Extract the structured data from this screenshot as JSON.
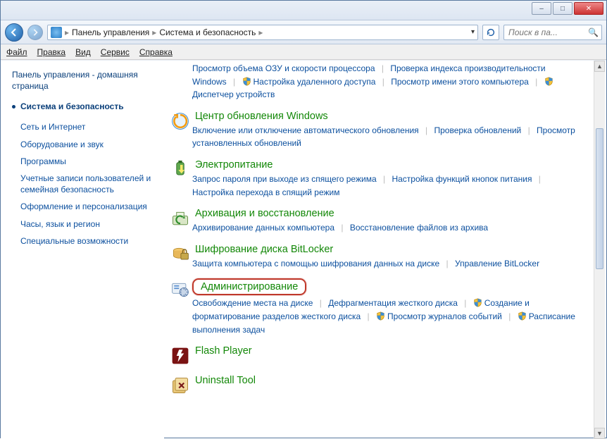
{
  "window": {
    "minimize": "–",
    "maximize": "□",
    "close": "✕"
  },
  "breadcrumb": {
    "root": "Панель управления",
    "current": "Система и безопасность"
  },
  "search": {
    "placeholder": "Поиск в па..."
  },
  "menubar": {
    "file": "Файл",
    "edit": "Правка",
    "view": "Вид",
    "tools": "Сервис",
    "help": "Справка"
  },
  "sidebar": {
    "home": "Панель управления - домашняя страница",
    "active": "Система и безопасность",
    "items": [
      "Сеть и Интернет",
      "Оборудование и звук",
      "Программы",
      "Учетные записи пользователей и семейная безопасность",
      "Оформление и персонализация",
      "Часы, язык и регион",
      "Специальные возможности"
    ]
  },
  "top_links": [
    {
      "label": "Просмотр объема ОЗУ и скорости процессора",
      "shield": false
    },
    {
      "label": "Проверка индекса производительности Windows",
      "shield": false
    },
    {
      "label": "Настройка удаленного доступа",
      "shield": true
    },
    {
      "label": "Просмотр имени этого компьютера",
      "shield": false
    },
    {
      "label": "Диспетчер устройств",
      "shield": true
    }
  ],
  "categories": [
    {
      "id": "windows-update",
      "title": "Центр обновления Windows",
      "icon": "windows-update-icon",
      "links": [
        {
          "label": "Включение или отключение автоматического обновления",
          "shield": false
        },
        {
          "label": "Проверка обновлений",
          "shield": false
        },
        {
          "label": "Просмотр установленных обновлений",
          "shield": false
        }
      ]
    },
    {
      "id": "power",
      "title": "Электропитание",
      "icon": "power-icon",
      "links": [
        {
          "label": "Запрос пароля при выходе из спящего режима",
          "shield": false
        },
        {
          "label": "Настройка функций кнопок питания",
          "shield": false
        },
        {
          "label": "Настройка перехода в спящий режим",
          "shield": false
        }
      ]
    },
    {
      "id": "backup",
      "title": "Архивация и восстановление",
      "icon": "backup-icon",
      "links": [
        {
          "label": "Архивирование данных компьютера",
          "shield": false
        },
        {
          "label": "Восстановление файлов из архива",
          "shield": false
        }
      ]
    },
    {
      "id": "bitlocker",
      "title": "Шифрование диска BitLocker",
      "icon": "bitlocker-icon",
      "links": [
        {
          "label": "Защита компьютера с помощью шифрования данных на диске",
          "shield": false
        },
        {
          "label": "Управление BitLocker",
          "shield": false
        }
      ]
    },
    {
      "id": "admin",
      "title": "Администрирование",
      "icon": "admin-icon",
      "highlight": true,
      "links": [
        {
          "label": "Освобождение места на диске",
          "shield": false
        },
        {
          "label": "Дефрагментация жесткого диска",
          "shield": false
        },
        {
          "label": "Создание и форматирование разделов жесткого диска",
          "shield": true
        },
        {
          "label": "Просмотр журналов событий",
          "shield": true
        },
        {
          "label": "Расписание выполнения задач",
          "shield": true
        }
      ]
    },
    {
      "id": "flash",
      "title": "Flash Player",
      "icon": "flash-icon",
      "links": []
    },
    {
      "id": "uninstall",
      "title": "Uninstall Tool",
      "icon": "uninstall-icon",
      "links": []
    }
  ]
}
